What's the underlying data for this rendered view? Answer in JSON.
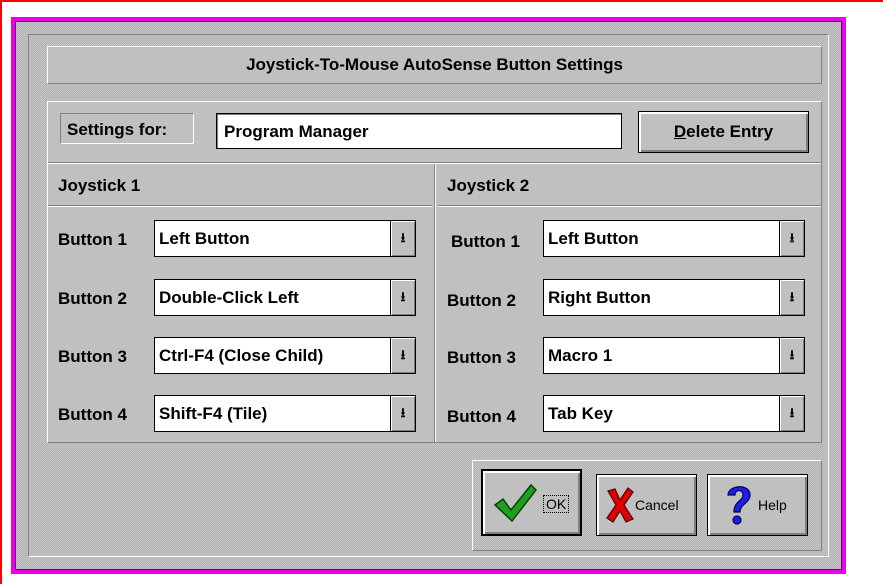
{
  "dialog": {
    "title": "Joystick-To-Mouse AutoSense Button Settings",
    "settings_for_label": "Settings for:",
    "settings_for_value": "Program Manager",
    "delete_entry_u": "D",
    "delete_entry_rest": "elete Entry"
  },
  "joystick1": {
    "header": "Joystick 1",
    "buttons": [
      {
        "label": "Button 1",
        "value": "Left Button"
      },
      {
        "label": "Button 2",
        "value": "Double-Click Left"
      },
      {
        "label": "Button 3",
        "value": "Ctrl-F4 (Close Child)"
      },
      {
        "label": "Button 4",
        "value": "Shift-F4 (Tile)"
      }
    ]
  },
  "joystick2": {
    "header": "Joystick 2",
    "buttons": [
      {
        "label": "Button 1",
        "value": "Left Button"
      },
      {
        "label": "Button 2",
        "value": "Right Button"
      },
      {
        "label": "Button 3",
        "value": "Macro 1"
      },
      {
        "label": "Button 4",
        "value": "Tab Key"
      }
    ]
  },
  "actions": {
    "ok": "OK",
    "cancel": "Cancel",
    "help": "Help"
  },
  "icons": {
    "dropdown_arrow": "dropdown-arrow-icon",
    "ok": "checkmark-icon",
    "cancel": "x-icon",
    "help": "question-mark-icon"
  },
  "colors": {
    "dialog_border": "#e800e8",
    "window_edge": "#ff0000",
    "ok_check": "#1ea01e",
    "cancel_x": "#e00000",
    "help_q": "#2020e0"
  }
}
